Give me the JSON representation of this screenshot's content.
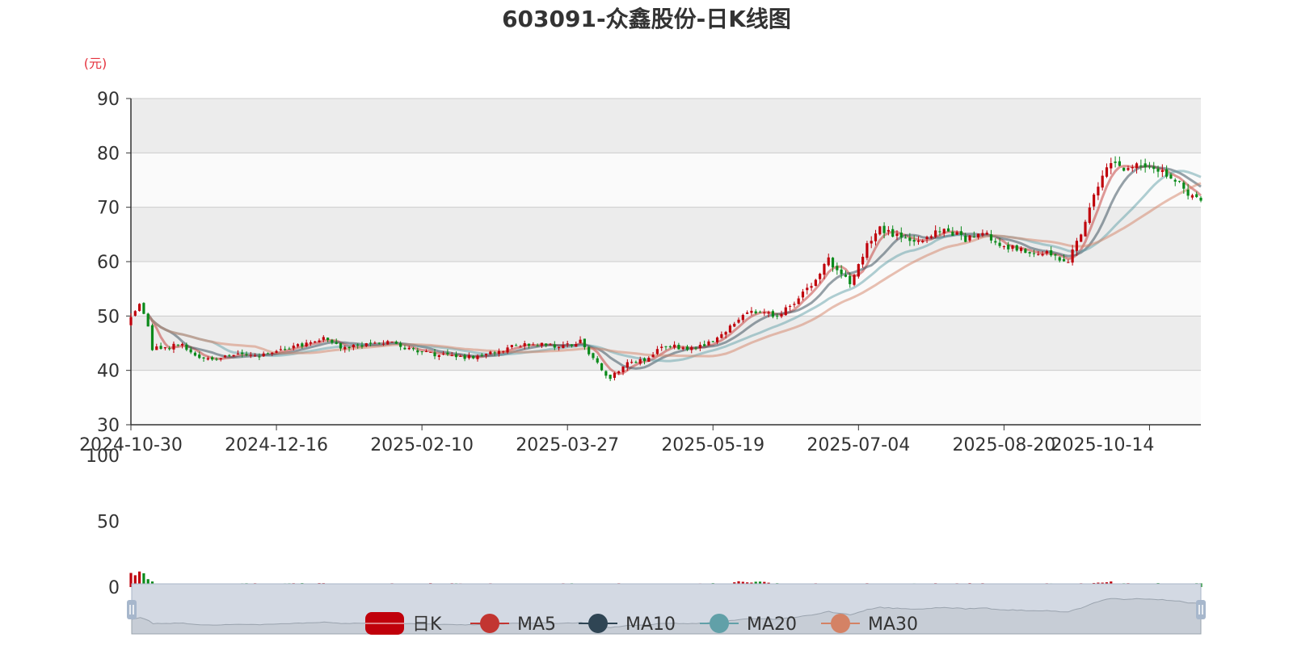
{
  "chart_data": {
    "type": "candlestick",
    "title": "603091-众鑫股份-日K线图",
    "y_unit": "(元)",
    "ylim": [
      30,
      90
    ],
    "y_ticks": [
      30,
      40,
      50,
      60,
      70,
      80,
      90
    ],
    "volume_ylim": [
      0,
      100
    ],
    "volume_ticks": [
      0,
      50,
      100
    ],
    "x_ticks": [
      "2024-10-30",
      "2024-12-16",
      "2025-02-10",
      "2025-03-27",
      "2025-05-19",
      "2025-07-04",
      "2025-08-20",
      "2025-10-14"
    ],
    "x_tick_positions": [
      0,
      34,
      68,
      102,
      136,
      170,
      204,
      238
    ],
    "n_days": 251,
    "close_anchors": [
      [
        0,
        50
      ],
      [
        2,
        52
      ],
      [
        4,
        48
      ],
      [
        5,
        44
      ],
      [
        8,
        44
      ],
      [
        12,
        45
      ],
      [
        15,
        42.5
      ],
      [
        18,
        42
      ],
      [
        25,
        43
      ],
      [
        30,
        42.5
      ],
      [
        35,
        44
      ],
      [
        40,
        44.5
      ],
      [
        45,
        46
      ],
      [
        50,
        44
      ],
      [
        55,
        45
      ],
      [
        60,
        45
      ],
      [
        65,
        44
      ],
      [
        70,
        43
      ],
      [
        75,
        42.5
      ],
      [
        80,
        42.5
      ],
      [
        85,
        43.5
      ],
      [
        90,
        44.5
      ],
      [
        97,
        45
      ],
      [
        100,
        44
      ],
      [
        105,
        45.5
      ],
      [
        108,
        42
      ],
      [
        112,
        38.5
      ],
      [
        115,
        41
      ],
      [
        120,
        42
      ],
      [
        125,
        44.5
      ],
      [
        130,
        44
      ],
      [
        135,
        45
      ],
      [
        140,
        48
      ],
      [
        145,
        51
      ],
      [
        150,
        50
      ],
      [
        155,
        52
      ],
      [
        160,
        57
      ],
      [
        163,
        61
      ],
      [
        165,
        58
      ],
      [
        168,
        56
      ],
      [
        172,
        63
      ],
      [
        175,
        66
      ],
      [
        178,
        65
      ],
      [
        182,
        64
      ],
      [
        186,
        64.5
      ],
      [
        190,
        66
      ],
      [
        195,
        64
      ],
      [
        200,
        65
      ],
      [
        205,
        62.5
      ],
      [
        210,
        62
      ],
      [
        215,
        61.5
      ],
      [
        219,
        60
      ],
      [
        222,
        65
      ],
      [
        226,
        74
      ],
      [
        229,
        78
      ],
      [
        233,
        77
      ],
      [
        237,
        78
      ],
      [
        240,
        77
      ],
      [
        244,
        75
      ],
      [
        248,
        72
      ],
      [
        251,
        71
      ],
      [
        255,
        73
      ],
      [
        259,
        74
      ],
      [
        261,
        73
      ]
    ],
    "series": [
      {
        "name": "日K",
        "color_up": "#c0000b",
        "color_down": "#0a8a1a"
      },
      {
        "name": "MA5",
        "period": 5,
        "color": "#c23531"
      },
      {
        "name": "MA10",
        "period": 10,
        "color": "#2f4554"
      },
      {
        "name": "MA20",
        "period": 20,
        "color": "#61a0a8"
      },
      {
        "name": "MA30",
        "period": 30,
        "color": "#d48265"
      }
    ],
    "legend_position": "bottom-center",
    "grid": true
  }
}
